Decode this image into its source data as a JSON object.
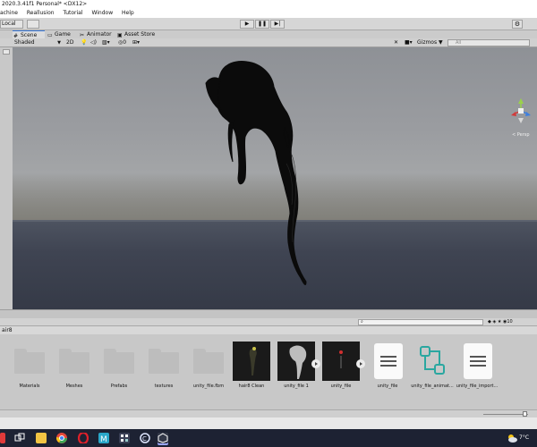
{
  "window": {
    "title": "2020.3.41f1 Personal* <DX12>"
  },
  "menu": [
    "achine",
    "Reallusion",
    "Tutorial",
    "Window",
    "Help"
  ],
  "toolbar": {
    "pivot_label": "Local"
  },
  "tabs": [
    {
      "label": "Scene",
      "icon": "scene-icon"
    },
    {
      "label": "Game",
      "icon": "game-icon"
    },
    {
      "label": "Animator",
      "icon": "animator-icon"
    },
    {
      "label": "Asset Store",
      "icon": "store-icon"
    }
  ],
  "viewport_toolbar": {
    "shading_mode": "Shaded",
    "mode_2d": "2D",
    "gizmos_label": "Gizmos",
    "search_placeholder": "All"
  },
  "viewport": {
    "projection_label": "< Persp"
  },
  "project": {
    "breadcrumb": "air8",
    "zoom_slider": 0.9,
    "assets": [
      {
        "label": "Materials",
        "kind": "folder"
      },
      {
        "label": "Meshes",
        "kind": "folder"
      },
      {
        "label": "Prefabs",
        "kind": "folder"
      },
      {
        "label": "textures",
        "kind": "folder"
      },
      {
        "label": "unity_file.fbm",
        "kind": "folder"
      },
      {
        "label": "hair8 Clean",
        "kind": "prefab"
      },
      {
        "label": "unity_file 1",
        "kind": "model"
      },
      {
        "label": "unity_file",
        "kind": "model"
      },
      {
        "label": "unity_file",
        "kind": "document"
      },
      {
        "label": "unity_file_animat...",
        "kind": "animator"
      },
      {
        "label": "unity_file_import...",
        "kind": "document"
      }
    ]
  },
  "taskbar": {
    "clock": "7°C"
  },
  "colors": {
    "accent": "#3a79d9",
    "taskbar": "#1d2233"
  }
}
